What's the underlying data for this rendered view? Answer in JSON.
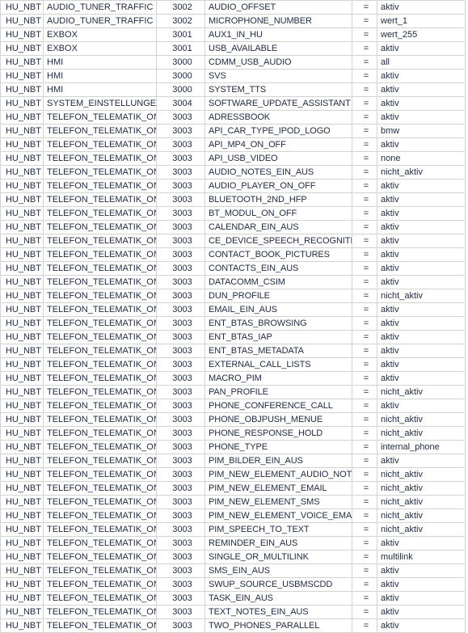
{
  "sheet": {
    "columns": [
      {
        "key": "ecu",
        "name": "ecu-column"
      },
      {
        "key": "module",
        "name": "module-column"
      },
      {
        "key": "number",
        "name": "number-column"
      },
      {
        "key": "parameter",
        "name": "parameter-column"
      },
      {
        "key": "operator",
        "name": "operator-column"
      },
      {
        "key": "value",
        "name": "value-column"
      }
    ],
    "grid_color": "#d4d4d4",
    "text_color": "#1f2a44",
    "background": "#ffffff",
    "rows": [
      {
        "ecu": "HU_NBT",
        "module": "AUDIO_TUNER_TRAFFIC",
        "number": "3002",
        "parameter": "AUDIO_OFFSET",
        "operator": "=",
        "value": "aktiv"
      },
      {
        "ecu": "HU_NBT",
        "module": "AUDIO_TUNER_TRAFFIC",
        "number": "3002",
        "parameter": "MICROPHONE_NUMBER",
        "operator": "=",
        "value": "wert_1"
      },
      {
        "ecu": "HU_NBT",
        "module": "EXBOX",
        "number": "3001",
        "parameter": "AUX1_IN_HU",
        "operator": "=",
        "value": "wert_255"
      },
      {
        "ecu": "HU_NBT",
        "module": "EXBOX",
        "number": "3001",
        "parameter": "USB_AVAILABLE",
        "operator": "=",
        "value": "aktiv"
      },
      {
        "ecu": "HU_NBT",
        "module": "HMI",
        "number": "3000",
        "parameter": "CDMM_USB_AUDIO",
        "operator": "=",
        "value": "all"
      },
      {
        "ecu": "HU_NBT",
        "module": "HMI",
        "number": "3000",
        "parameter": "SVS",
        "operator": "=",
        "value": "aktiv"
      },
      {
        "ecu": "HU_NBT",
        "module": "HMI",
        "number": "3000",
        "parameter": "SYSTEM_TTS",
        "operator": "=",
        "value": "aktiv"
      },
      {
        "ecu": "HU_NBT",
        "module": "SYSTEM_EINSTELLUNGEN",
        "number": "3004",
        "parameter": "SOFTWARE_UPDATE_ASSISTANT",
        "operator": "=",
        "value": "aktiv"
      },
      {
        "ecu": "HU_NBT",
        "module": "TELEFON_TELEMATIK_ONLINE",
        "number": "3003",
        "parameter": "ADRESSBOOK",
        "operator": "=",
        "value": "aktiv"
      },
      {
        "ecu": "HU_NBT",
        "module": "TELEFON_TELEMATIK_ONLINE",
        "number": "3003",
        "parameter": "API_CAR_TYPE_IPOD_LOGO",
        "operator": "=",
        "value": "bmw"
      },
      {
        "ecu": "HU_NBT",
        "module": "TELEFON_TELEMATIK_ONLINE",
        "number": "3003",
        "parameter": "API_MP4_ON_OFF",
        "operator": "=",
        "value": "aktiv"
      },
      {
        "ecu": "HU_NBT",
        "module": "TELEFON_TELEMATIK_ONLINE",
        "number": "3003",
        "parameter": "API_USB_VIDEO",
        "operator": "=",
        "value": "none"
      },
      {
        "ecu": "HU_NBT",
        "module": "TELEFON_TELEMATIK_ONLINE",
        "number": "3003",
        "parameter": "AUDIO_NOTES_EIN_AUS",
        "operator": "=",
        "value": "nicht_aktiv"
      },
      {
        "ecu": "HU_NBT",
        "module": "TELEFON_TELEMATIK_ONLINE",
        "number": "3003",
        "parameter": "AUDIO_PLAYER_ON_OFF",
        "operator": "=",
        "value": "aktiv"
      },
      {
        "ecu": "HU_NBT",
        "module": "TELEFON_TELEMATIK_ONLINE",
        "number": "3003",
        "parameter": "BLUETOOTH_2ND_HFP",
        "operator": "=",
        "value": "aktiv"
      },
      {
        "ecu": "HU_NBT",
        "module": "TELEFON_TELEMATIK_ONLINE",
        "number": "3003",
        "parameter": "BT_MODUL_ON_OFF",
        "operator": "=",
        "value": "aktiv"
      },
      {
        "ecu": "HU_NBT",
        "module": "TELEFON_TELEMATIK_ONLINE",
        "number": "3003",
        "parameter": "CALENDAR_EIN_AUS",
        "operator": "=",
        "value": "aktiv"
      },
      {
        "ecu": "HU_NBT",
        "module": "TELEFON_TELEMATIK_ONLINE",
        "number": "3003",
        "parameter": "CE_DEVICE_SPEECH_RECOGNITION",
        "operator": "=",
        "value": "aktiv"
      },
      {
        "ecu": "HU_NBT",
        "module": "TELEFON_TELEMATIK_ONLINE",
        "number": "3003",
        "parameter": "CONTACT_BOOK_PICTURES",
        "operator": "=",
        "value": "aktiv"
      },
      {
        "ecu": "HU_NBT",
        "module": "TELEFON_TELEMATIK_ONLINE",
        "number": "3003",
        "parameter": "CONTACTS_EIN_AUS",
        "operator": "=",
        "value": "aktiv"
      },
      {
        "ecu": "HU_NBT",
        "module": "TELEFON_TELEMATIK_ONLINE",
        "number": "3003",
        "parameter": "DATACOMM_CSIM",
        "operator": "=",
        "value": "aktiv"
      },
      {
        "ecu": "HU_NBT",
        "module": "TELEFON_TELEMATIK_ONLINE",
        "number": "3003",
        "parameter": "DUN_PROFILE",
        "operator": "=",
        "value": "nicht_aktiv"
      },
      {
        "ecu": "HU_NBT",
        "module": "TELEFON_TELEMATIK_ONLINE",
        "number": "3003",
        "parameter": "EMAIL_EIN_AUS",
        "operator": "=",
        "value": "aktiv"
      },
      {
        "ecu": "HU_NBT",
        "module": "TELEFON_TELEMATIK_ONLINE",
        "number": "3003",
        "parameter": "ENT_BTAS_BROWSING",
        "operator": "=",
        "value": "aktiv"
      },
      {
        "ecu": "HU_NBT",
        "module": "TELEFON_TELEMATIK_ONLINE",
        "number": "3003",
        "parameter": "ENT_BTAS_IAP",
        "operator": "=",
        "value": "aktiv"
      },
      {
        "ecu": "HU_NBT",
        "module": "TELEFON_TELEMATIK_ONLINE",
        "number": "3003",
        "parameter": "ENT_BTAS_METADATA",
        "operator": "=",
        "value": "aktiv"
      },
      {
        "ecu": "HU_NBT",
        "module": "TELEFON_TELEMATIK_ONLINE",
        "number": "3003",
        "parameter": "EXTERNAL_CALL_LISTS",
        "operator": "=",
        "value": "aktiv"
      },
      {
        "ecu": "HU_NBT",
        "module": "TELEFON_TELEMATIK_ONLINE",
        "number": "3003",
        "parameter": "MACRO_PIM",
        "operator": "=",
        "value": "aktiv"
      },
      {
        "ecu": "HU_NBT",
        "module": "TELEFON_TELEMATIK_ONLINE",
        "number": "3003",
        "parameter": "PAN_PROFILE",
        "operator": "=",
        "value": "nicht_aktiv"
      },
      {
        "ecu": "HU_NBT",
        "module": "TELEFON_TELEMATIK_ONLINE",
        "number": "3003",
        "parameter": "PHONE_CONFERENCE_CALL",
        "operator": "=",
        "value": "aktiv"
      },
      {
        "ecu": "HU_NBT",
        "module": "TELEFON_TELEMATIK_ONLINE",
        "number": "3003",
        "parameter": "PHONE_OBJPUSH_MENUE",
        "operator": "=",
        "value": "nicht_aktiv"
      },
      {
        "ecu": "HU_NBT",
        "module": "TELEFON_TELEMATIK_ONLINE",
        "number": "3003",
        "parameter": "PHONE_RESPONSE_HOLD",
        "operator": "=",
        "value": "nicht_aktiv"
      },
      {
        "ecu": "HU_NBT",
        "module": "TELEFON_TELEMATIK_ONLINE",
        "number": "3003",
        "parameter": "PHONE_TYPE",
        "operator": "=",
        "value": "internal_phone"
      },
      {
        "ecu": "HU_NBT",
        "module": "TELEFON_TELEMATIK_ONLINE",
        "number": "3003",
        "parameter": "PIM_BILDER_EIN_AUS",
        "operator": "=",
        "value": "aktiv"
      },
      {
        "ecu": "HU_NBT",
        "module": "TELEFON_TELEMATIK_ONLINE",
        "number": "3003",
        "parameter": "PIM_NEW_ELEMENT_AUDIO_NOTE",
        "operator": "=",
        "value": "nicht_aktiv"
      },
      {
        "ecu": "HU_NBT",
        "module": "TELEFON_TELEMATIK_ONLINE",
        "number": "3003",
        "parameter": "PIM_NEW_ELEMENT_EMAIL",
        "operator": "=",
        "value": "nicht_aktiv"
      },
      {
        "ecu": "HU_NBT",
        "module": "TELEFON_TELEMATIK_ONLINE",
        "number": "3003",
        "parameter": "PIM_NEW_ELEMENT_SMS",
        "operator": "=",
        "value": "nicht_aktiv"
      },
      {
        "ecu": "HU_NBT",
        "module": "TELEFON_TELEMATIK_ONLINE",
        "number": "3003",
        "parameter": "PIM_NEW_ELEMENT_VOICE_EMAIL",
        "operator": "=",
        "value": "nicht_aktiv"
      },
      {
        "ecu": "HU_NBT",
        "module": "TELEFON_TELEMATIK_ONLINE",
        "number": "3003",
        "parameter": "PIM_SPEECH_TO_TEXT",
        "operator": "=",
        "value": "nicht_aktiv"
      },
      {
        "ecu": "HU_NBT",
        "module": "TELEFON_TELEMATIK_ONLINE",
        "number": "3003",
        "parameter": "REMINDER_EIN_AUS",
        "operator": "=",
        "value": "aktiv"
      },
      {
        "ecu": "HU_NBT",
        "module": "TELEFON_TELEMATIK_ONLINE",
        "number": "3003",
        "parameter": "SINGLE_OR_MULTILINK",
        "operator": "=",
        "value": "multilink"
      },
      {
        "ecu": "HU_NBT",
        "module": "TELEFON_TELEMATIK_ONLINE",
        "number": "3003",
        "parameter": "SMS_EIN_AUS",
        "operator": "=",
        "value": "aktiv"
      },
      {
        "ecu": "HU_NBT",
        "module": "TELEFON_TELEMATIK_ONLINE",
        "number": "3003",
        "parameter": "SWUP_SOURCE_USBMSCDD",
        "operator": "=",
        "value": "aktiv"
      },
      {
        "ecu": "HU_NBT",
        "module": "TELEFON_TELEMATIK_ONLINE",
        "number": "3003",
        "parameter": "TASK_EIN_AUS",
        "operator": "=",
        "value": "aktiv"
      },
      {
        "ecu": "HU_NBT",
        "module": "TELEFON_TELEMATIK_ONLINE",
        "number": "3003",
        "parameter": "TEXT_NOTES_EIN_AUS",
        "operator": "=",
        "value": "aktiv"
      },
      {
        "ecu": "HU_NBT",
        "module": "TELEFON_TELEMATIK_ONLINE",
        "number": "3003",
        "parameter": "TWO_PHONES_PARALLEL",
        "operator": "=",
        "value": "aktiv"
      }
    ]
  }
}
